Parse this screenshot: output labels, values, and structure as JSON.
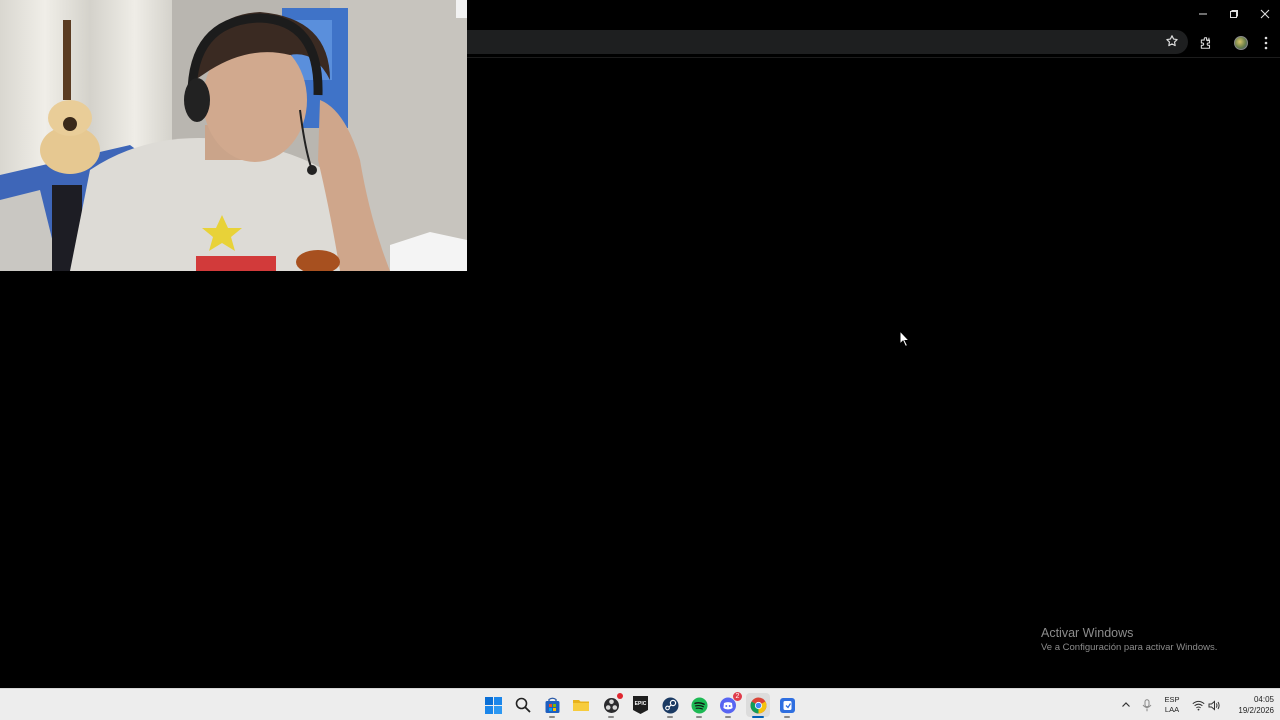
{
  "watermark": {
    "title": "Activar Windows",
    "subtitle": "Ve a Configuración para activar Windows."
  },
  "browser": {
    "icons": [
      "bookmark-star-icon",
      "extensions-icon",
      "profile-avatar-icon",
      "kebab-menu-icon"
    ],
    "window_controls": [
      "minimize-icon",
      "restore-icon",
      "close-icon"
    ]
  },
  "taskbar": {
    "apps": [
      {
        "name": "start",
        "icon": "windows-logo-icon"
      },
      {
        "name": "search",
        "icon": "search-icon"
      },
      {
        "name": "microsoft-store",
        "icon": "store-icon"
      },
      {
        "name": "file-explorer",
        "icon": "folder-icon"
      },
      {
        "name": "obs",
        "icon": "obs-icon"
      },
      {
        "name": "epic-games",
        "icon": "epic-games-icon",
        "label": "EPIC"
      },
      {
        "name": "steam",
        "icon": "steam-icon"
      },
      {
        "name": "spotify",
        "icon": "spotify-icon"
      },
      {
        "name": "discord",
        "icon": "discord-icon",
        "badge": "2"
      },
      {
        "name": "chrome",
        "icon": "chrome-icon"
      },
      {
        "name": "app",
        "icon": "blue-app-icon"
      }
    ],
    "tray": {
      "language_line1": "ESP",
      "language_line2": "LAA",
      "time": "04:05",
      "date": "19/2/2026"
    }
  },
  "colors": {
    "windows_blue": "#0078d4",
    "spotify_green": "#1db954",
    "discord_blurple": "#5865f2",
    "taskbar_bg": "#ededed"
  }
}
